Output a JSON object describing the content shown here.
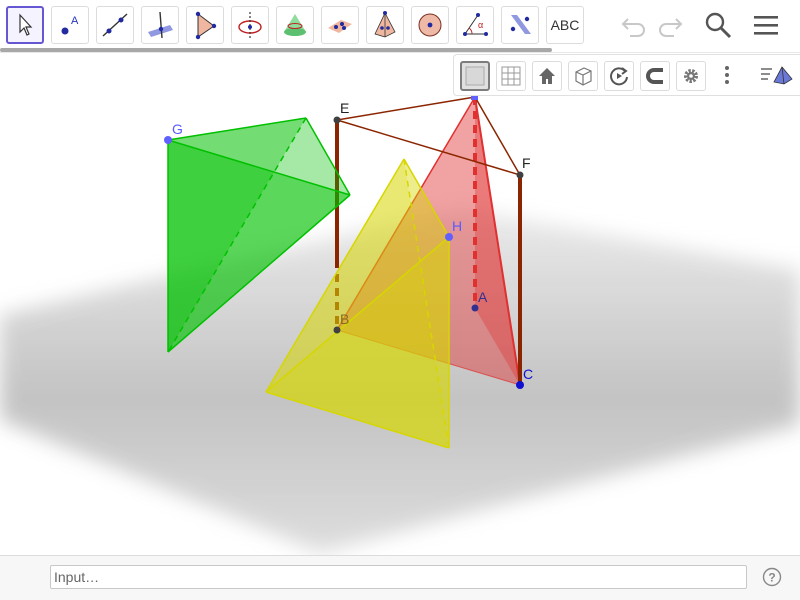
{
  "toolbar": {
    "tools": [
      {
        "name": "move-tool",
        "icon": "arrow-pointer-icon"
      },
      {
        "name": "point-tool",
        "icon": "point-icon",
        "label": "A"
      },
      {
        "name": "line-tool",
        "icon": "line-icon"
      },
      {
        "name": "perpendicular-line-tool",
        "icon": "perpendicular-icon"
      },
      {
        "name": "pyramid-tool",
        "icon": "triangle-icon"
      },
      {
        "name": "circle-axis-tool",
        "icon": "circle-axis-icon"
      },
      {
        "name": "cone-tool",
        "icon": "cone-icon"
      },
      {
        "name": "plane-tool",
        "icon": "plane-icon"
      },
      {
        "name": "prism-tool",
        "icon": "pyramid-icon"
      },
      {
        "name": "sphere-tool",
        "icon": "sphere-icon"
      },
      {
        "name": "angle-tool",
        "icon": "angle-icon"
      },
      {
        "name": "reflect-tool",
        "icon": "reflect-plane-icon"
      },
      {
        "name": "text-tool",
        "icon": "text-icon",
        "label": "ABC"
      }
    ],
    "angle_glyph": "α"
  },
  "graphics_style_bar": {
    "buttons": [
      "plane-toggle-icon",
      "grid-icon",
      "home-icon",
      "view-cube-icon",
      "rotate-view-icon",
      "snap-magnet-icon",
      "settings-gear-icon"
    ],
    "menu_icon": "more-vert-icon",
    "view_icon": "3d-view-icon"
  },
  "scene": {
    "labels": {
      "E": "E",
      "F": "F",
      "G": "G",
      "H": "H",
      "A": "A",
      "B": "B",
      "C": "C"
    },
    "colors": {
      "green": "#00c000",
      "red": "#e03030",
      "yellow": "#d6d600",
      "brown": "#8b2500",
      "point_blue": "#6060ff",
      "point_dark": "#404040"
    }
  },
  "input": {
    "placeholder": "Input…",
    "help_glyph": "?"
  }
}
